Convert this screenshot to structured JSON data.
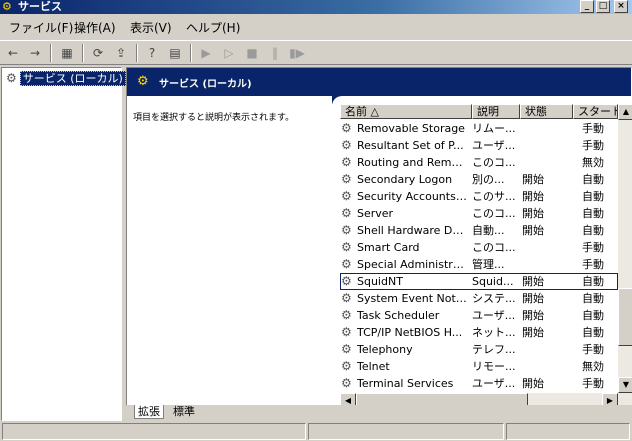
{
  "window": {
    "title": "サービス",
    "minimize": "_",
    "restore": "□",
    "close": "×"
  },
  "menu": [
    "ファイル(F)",
    "操作(A)",
    "表示(V)",
    "ヘルプ(H)"
  ],
  "tree": {
    "item_label": "サービス (ローカル)"
  },
  "banner": {
    "title": "サービス (ローカル)"
  },
  "description_hint": "項目を選択すると説明が表示されます。",
  "list": {
    "headers": [
      "名前 △",
      "説明",
      "状態",
      "スタートアップ"
    ],
    "rows": [
      {
        "name": "Removable Storage",
        "desc": "リムー...",
        "state": "",
        "start": "手動"
      },
      {
        "name": "Resultant Set of P...",
        "desc": "ユーザ...",
        "state": "",
        "start": "手動"
      },
      {
        "name": "Routing and Remot...",
        "desc": "このコ...",
        "state": "",
        "start": "無効"
      },
      {
        "name": "Secondary Logon",
        "desc": "別の...",
        "state": "開始",
        "start": "自動"
      },
      {
        "name": "Security Accounts ...",
        "desc": "このサ...",
        "state": "開始",
        "start": "自動"
      },
      {
        "name": "Server",
        "desc": "このコ...",
        "state": "開始",
        "start": "自動"
      },
      {
        "name": "Shell Hardware Det...",
        "desc": "自動...",
        "state": "開始",
        "start": "自動"
      },
      {
        "name": "Smart Card",
        "desc": "このコ...",
        "state": "",
        "start": "手動"
      },
      {
        "name": "Special Administrat...",
        "desc": "管理...",
        "state": "",
        "start": "手動"
      },
      {
        "name": "SquidNT",
        "desc": "Squid...",
        "state": "開始",
        "start": "自動",
        "focused": true
      },
      {
        "name": "System Event Notif...",
        "desc": "システ...",
        "state": "開始",
        "start": "自動"
      },
      {
        "name": "Task Scheduler",
        "desc": "ユーザ...",
        "state": "開始",
        "start": "自動"
      },
      {
        "name": "TCP/IP NetBIOS H...",
        "desc": "ネット...",
        "state": "開始",
        "start": "自動"
      },
      {
        "name": "Telephony",
        "desc": "テレフ...",
        "state": "",
        "start": "手動"
      },
      {
        "name": "Telnet",
        "desc": "リモー...",
        "state": "",
        "start": "無効"
      },
      {
        "name": "Terminal Services",
        "desc": "ユーザ...",
        "state": "開始",
        "start": "手動"
      }
    ]
  },
  "tabs": [
    "拡張",
    "標準"
  ],
  "scroll": {
    "up": "▲",
    "down": "▼",
    "left": "◀",
    "right": "▶"
  },
  "icons": {
    "gear": "⚙",
    "back": "←",
    "forward": "→",
    "up": "▦",
    "refresh": "⟳",
    "export": "⇪",
    "help": "?",
    "props": "▤",
    "play": "▶",
    "play2": "▷",
    "stop": "■",
    "pause": "‖",
    "restart": "▮▶"
  }
}
